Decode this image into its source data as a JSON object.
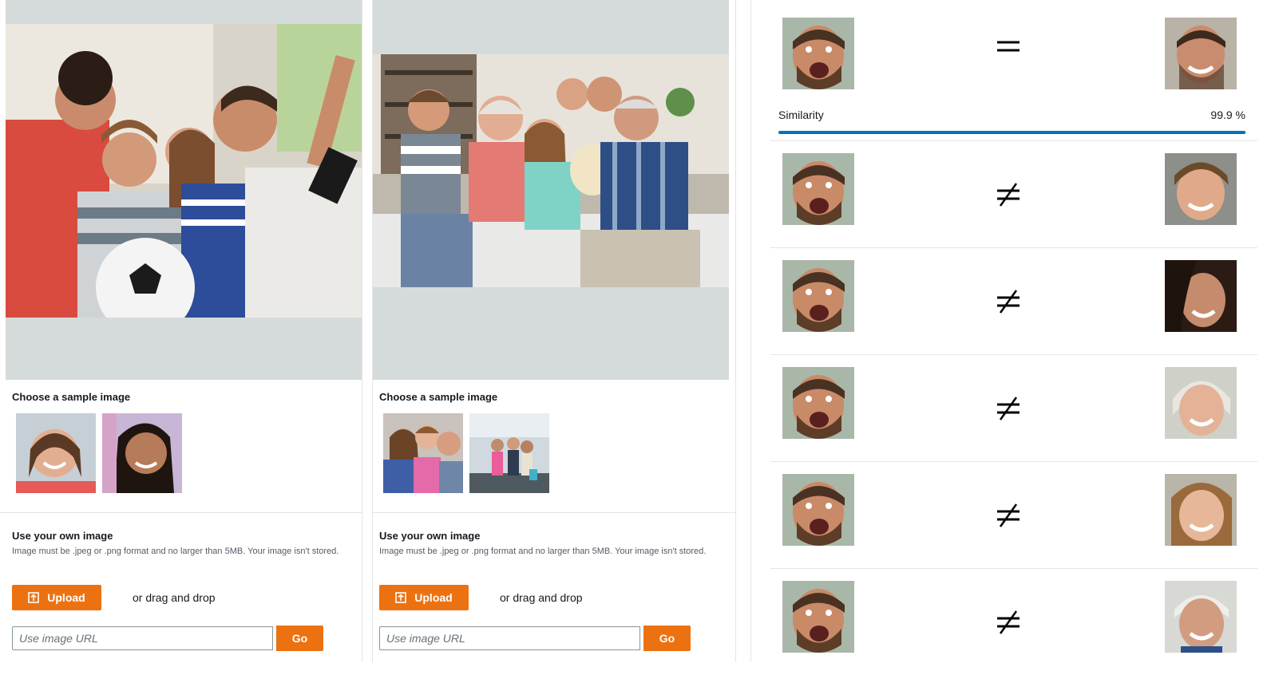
{
  "source_panel": {
    "sample_title": "Choose a sample image",
    "own_title": "Use your own image",
    "own_hint": "Image must be .jpeg or .png format and no larger than 5MB. Your image isn't stored.",
    "upload_label": "Upload",
    "drag_drop": "or drag and drop",
    "url_placeholder": "Use image URL",
    "go_label": "Go",
    "samples": [
      "girl-smiling-thumbnail",
      "girl-long-hair-thumbnail"
    ]
  },
  "target_panel": {
    "sample_title": "Choose a sample image",
    "own_title": "Use your own image",
    "own_hint": "Image must be .jpeg or .png format and no larger than 5MB. Your image isn't stored.",
    "upload_label": "Upload",
    "drag_drop": "or drag and drop",
    "url_placeholder": "Use image URL",
    "go_label": "Go",
    "samples": [
      "girls-looking-at-phone-thumbnail",
      "girls-in-mall-thumbnail"
    ]
  },
  "results": {
    "similarity_label": "Similarity",
    "similarity_value": "99.9 %",
    "similarity_fraction": 0.999,
    "rows": [
      {
        "match": true,
        "target_face": "man-smiling-face"
      },
      {
        "match": false,
        "target_face": "boy-face"
      },
      {
        "match": false,
        "target_face": "woman-dark-hair-face"
      },
      {
        "match": false,
        "target_face": "older-woman-face"
      },
      {
        "match": false,
        "target_face": "girl-face"
      },
      {
        "match": false,
        "target_face": "older-man-face"
      }
    ]
  },
  "colors": {
    "accent": "#ec7211",
    "similarity_bar": "#0073bb",
    "preview_bg": "#d5dbdb"
  }
}
